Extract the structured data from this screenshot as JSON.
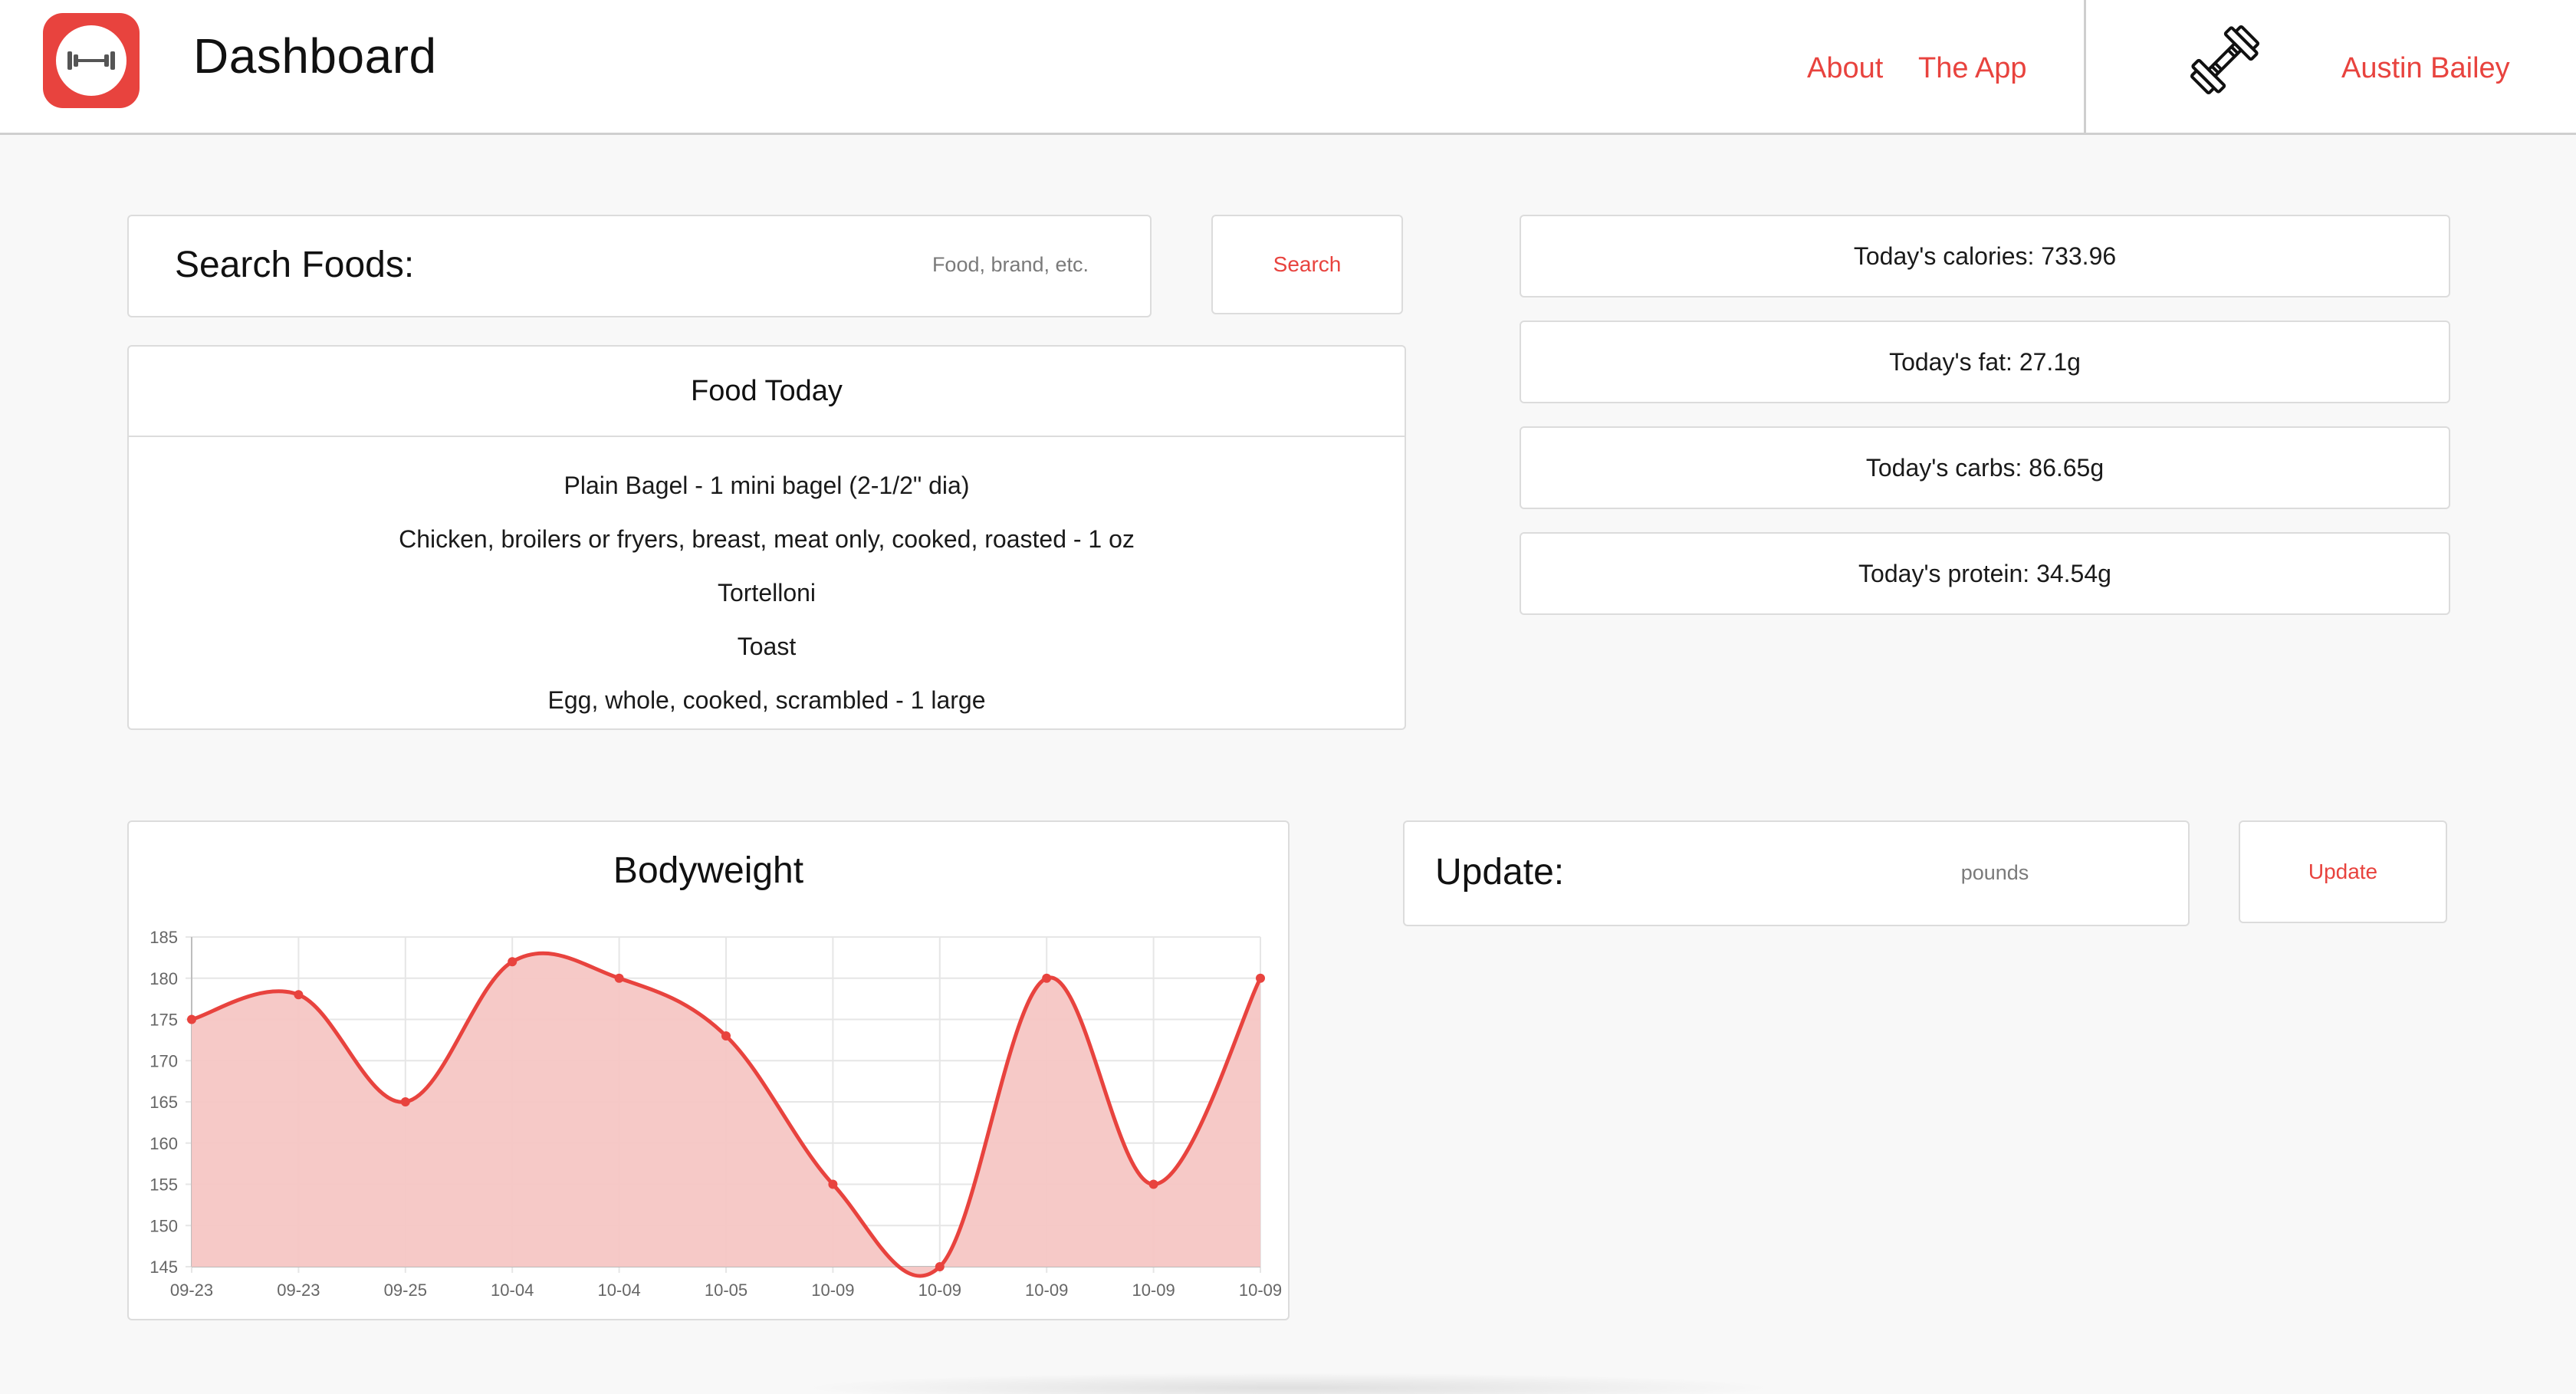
{
  "nav": {
    "brand": "Dashboard",
    "links": [
      "About",
      "The App"
    ],
    "user_name": "Austin Bailey",
    "logo_icon": "dumbbell-icon",
    "profile_icon": "dumbbell-outline-icon"
  },
  "search": {
    "label": "Search Foods:",
    "placeholder": "Food, brand, etc.",
    "button_label": "Search"
  },
  "food_today": {
    "title": "Food Today",
    "items": [
      "Plain Bagel - 1 mini bagel (2-1/2\" dia)",
      "Chicken, broilers or fryers, breast, meat only, cooked, roasted - 1 oz",
      "Tortelloni",
      "Toast",
      "Egg, whole, cooked, scrambled - 1 large"
    ]
  },
  "stats": [
    "Today's calories: 733.96",
    "Today's fat: 27.1g",
    "Today's carbs: 86.65g",
    "Today's protein: 34.54g"
  ],
  "update": {
    "label": "Update:",
    "placeholder": "pounds",
    "button_label": "Update"
  },
  "colors": {
    "accent": "#e8433e",
    "fill": "#f5c6c4",
    "background": "#f8f8f8",
    "border": "#dcdcdc"
  },
  "chart_data": {
    "type": "area",
    "title": "Bodyweight",
    "x": [
      "09-23",
      "09-23",
      "09-25",
      "10-04",
      "10-04",
      "10-05",
      "10-09",
      "10-09",
      "10-09",
      "10-09",
      "10-09"
    ],
    "series": [
      {
        "values": [
          175,
          178,
          165,
          182,
          180,
          173,
          155,
          145,
          180,
          155,
          180
        ]
      }
    ],
    "ylim": [
      145,
      185
    ],
    "yticks": [
      145,
      150,
      155,
      160,
      165,
      170,
      175,
      180,
      185
    ],
    "grid": true,
    "smooth": true
  }
}
